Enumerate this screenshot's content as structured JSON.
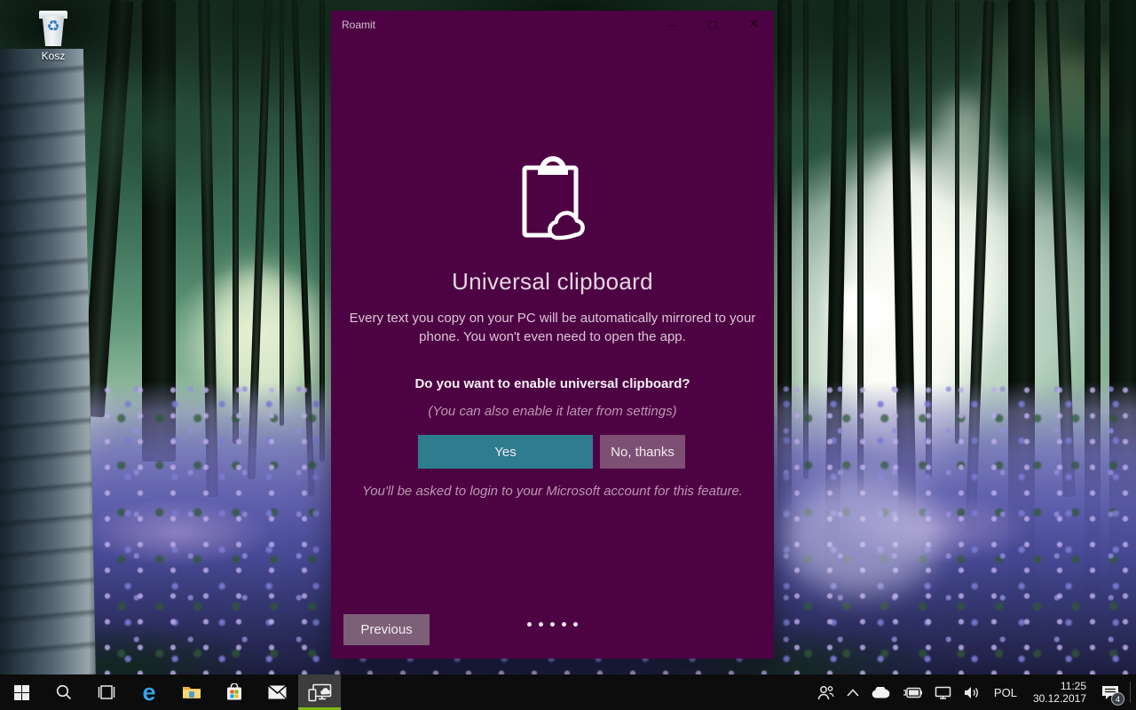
{
  "desktop": {
    "recycle_bin": {
      "label": "Kosz",
      "icon": "recycle-bin-icon"
    }
  },
  "window": {
    "title": "Roamit",
    "controls": {
      "minimize_glyph": "–",
      "maximize_glyph": "□",
      "close_glyph": "×"
    },
    "page": {
      "icon": "clipboard-cloud-icon",
      "heading": "Universal clipboard",
      "description": "Every text you copy on your PC will be automatically mirrored to your phone. You won't even need to open the app.",
      "question": "Do you want to enable universal clipboard?",
      "settings_note": "(You can also enable it later from settings)",
      "yes_label": "Yes",
      "no_label": "No, thanks",
      "account_note": "You'll be asked to login to your Microsoft account for this feature.",
      "previous_label": "Previous",
      "pagination": {
        "total_dots": 5,
        "style": "dots"
      }
    },
    "colors": {
      "window_background": "#4d0343",
      "yes_button": "#2e7d8e",
      "no_button": "#7d5073",
      "previous_button": "#7d6077"
    }
  },
  "taskbar": {
    "apps": [
      {
        "name": "start",
        "icon": "windows-logo-icon"
      },
      {
        "name": "search",
        "icon": "search-icon"
      },
      {
        "name": "task-view",
        "icon": "task-view-icon"
      },
      {
        "name": "edge",
        "icon": "edge-icon"
      },
      {
        "name": "file-explorer",
        "icon": "folder-icon"
      },
      {
        "name": "store",
        "icon": "store-icon"
      },
      {
        "name": "mail",
        "icon": "mail-icon"
      },
      {
        "name": "roamit",
        "icon": "pc-phone-cloud-icon",
        "active": true
      }
    ],
    "tray": {
      "icons": [
        "people-icon",
        "chevron-up-icon",
        "onedrive-cloud-icon",
        "battery-charging-icon",
        "network-icon",
        "volume-icon"
      ],
      "language": "POL",
      "time": "11:25",
      "date": "30.12.2017",
      "notification_count": "4",
      "accent_underline": "#7fb717"
    }
  }
}
